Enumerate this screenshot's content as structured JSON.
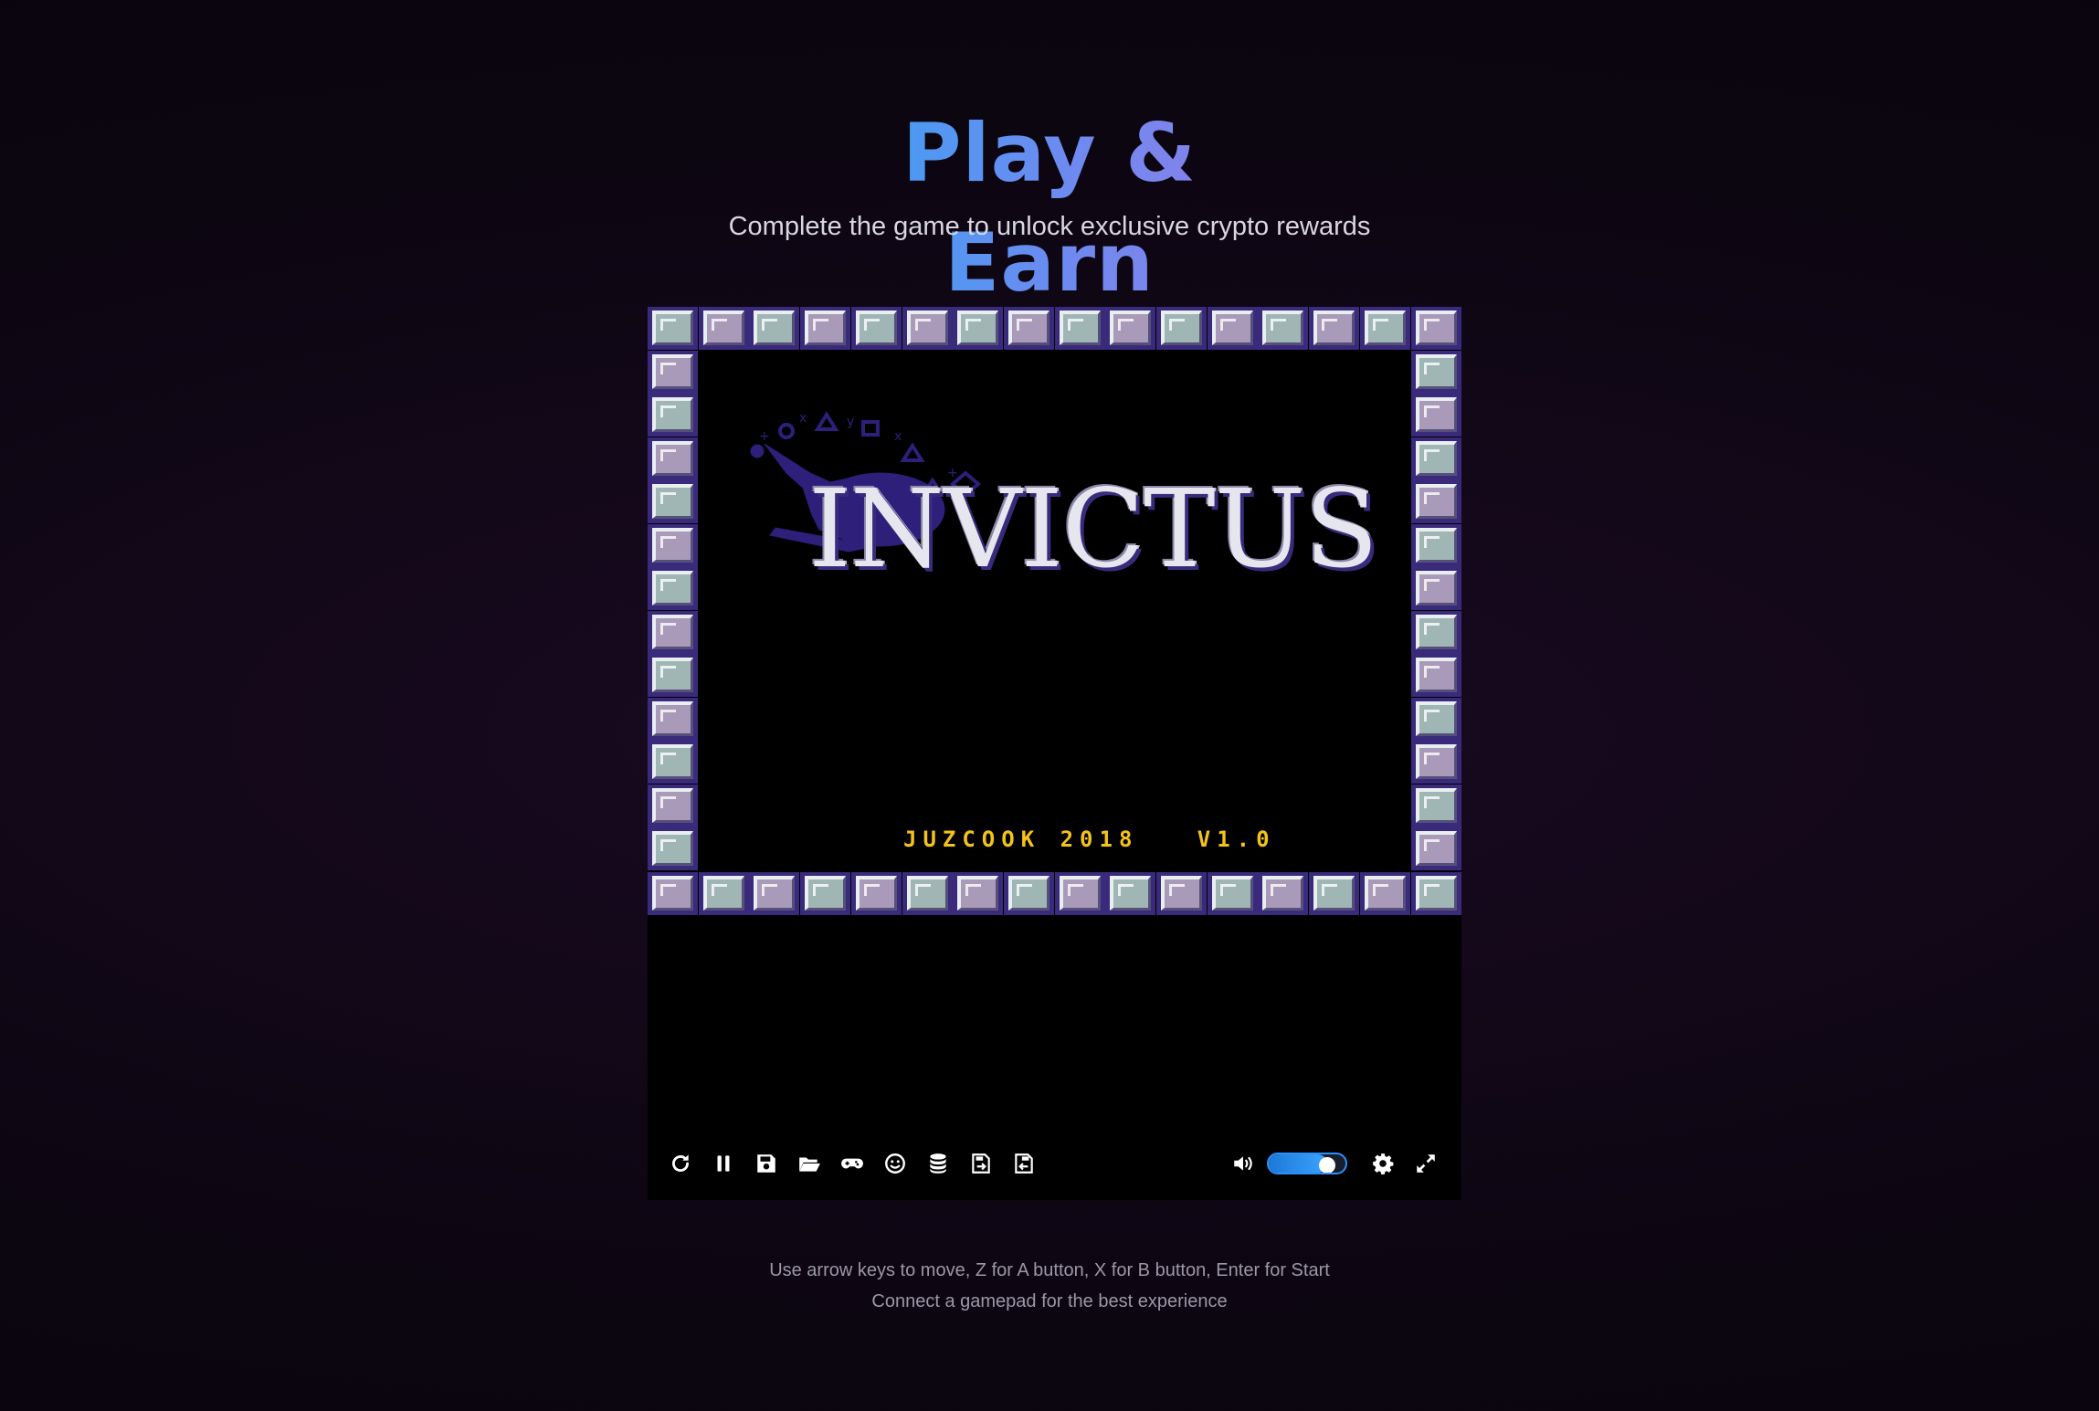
{
  "header": {
    "title": "Play & Earn",
    "subtitle": "Complete the game to unlock exclusive crypto rewards"
  },
  "game": {
    "logo_text": "INVICTUS",
    "credits": "JUZCOOK 2018   V1.0"
  },
  "toolbar": {
    "left_buttons": [
      {
        "icon": "restart-icon",
        "label": "Restart"
      },
      {
        "icon": "pause-icon",
        "label": "Pause"
      },
      {
        "icon": "save-state-icon",
        "label": "Save State"
      },
      {
        "icon": "load-state-icon",
        "label": "Load State"
      },
      {
        "icon": "gamepad-icon",
        "label": "Control Settings"
      },
      {
        "icon": "cheats-icon",
        "label": "Cheats"
      },
      {
        "icon": "cache-icon",
        "label": "Cache Manager"
      },
      {
        "icon": "export-save-icon",
        "label": "Export Save File"
      },
      {
        "icon": "import-save-icon",
        "label": "Import Save File"
      }
    ],
    "volume": {
      "icon": "volume-icon",
      "level": 0.85
    },
    "settings_icon": "gear-icon",
    "fullscreen_icon": "fullscreen-icon"
  },
  "hints": {
    "controls": "Use arrow keys to move, Z for A button, X for B button, Enter for Start",
    "gamepad": "Connect a gamepad for the best experience"
  },
  "colors": {
    "title_gradient_start": "#3fa0f3",
    "title_gradient_end": "#8a7fe8",
    "credits_yellow": "#f3c31b",
    "slider_accent": "#2a90ff"
  }
}
